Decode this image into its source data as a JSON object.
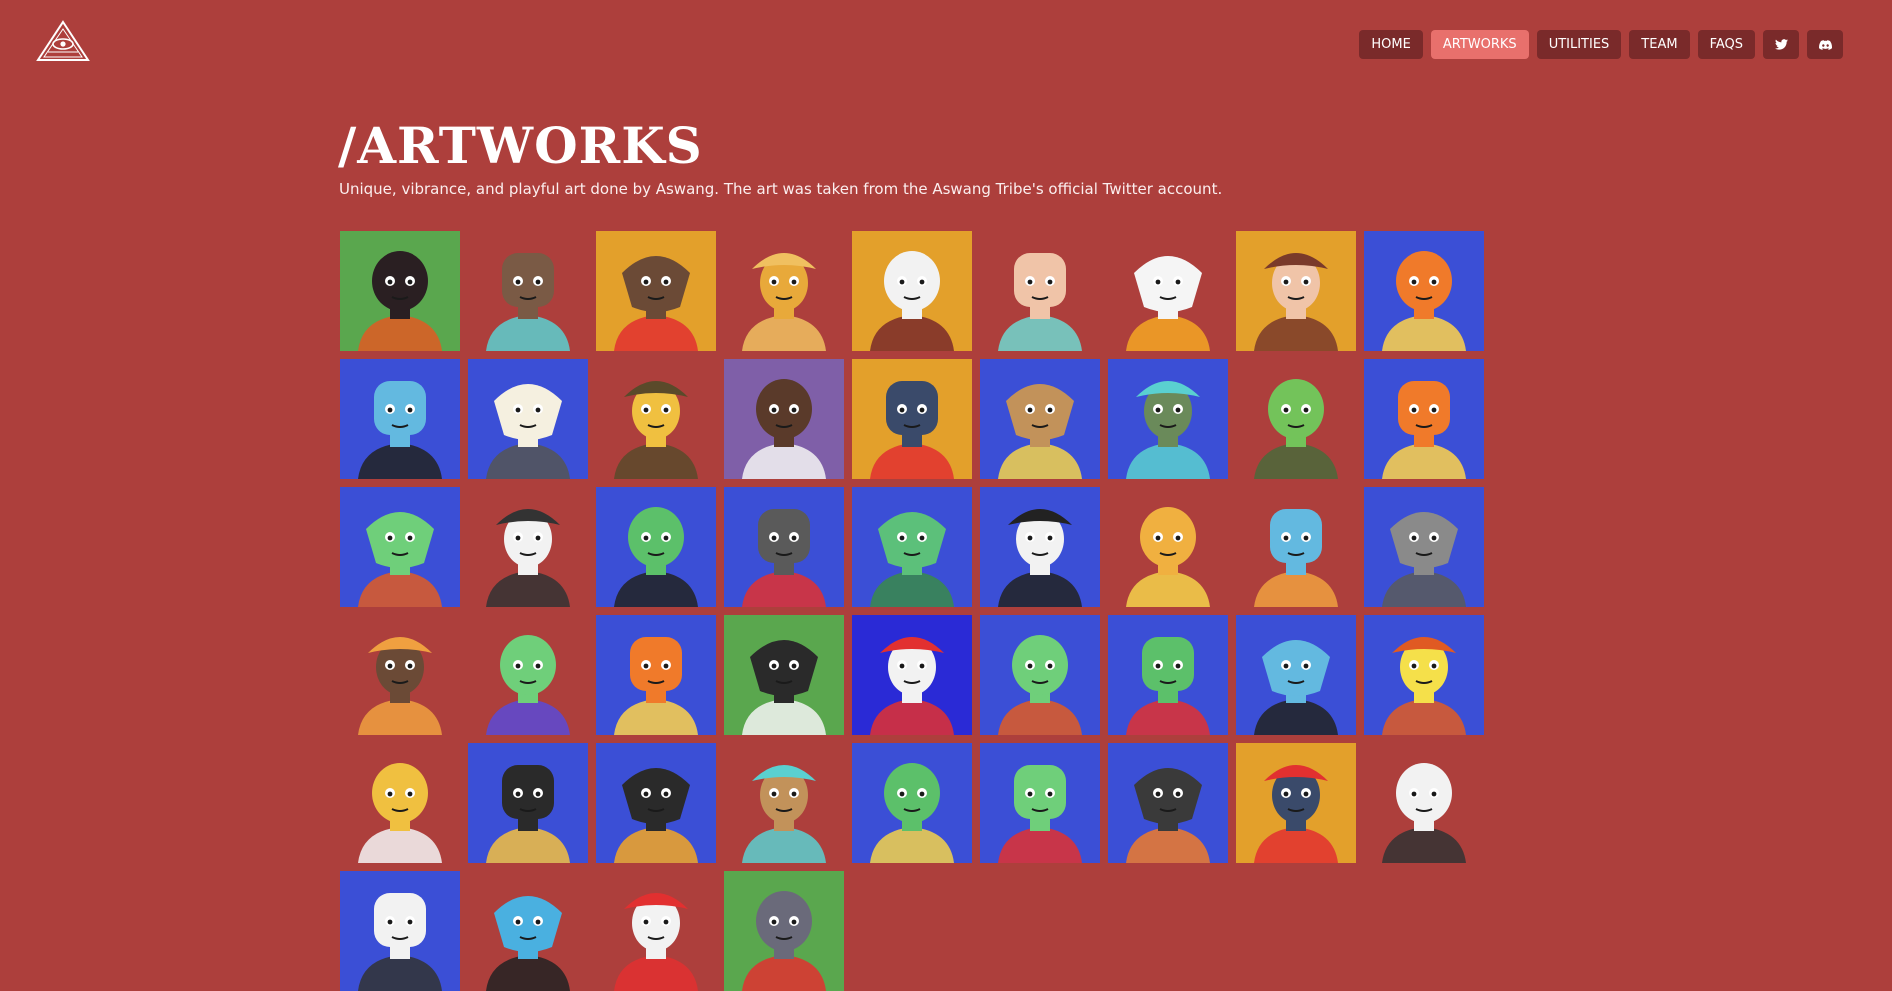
{
  "header": {
    "logo_icon": "eye-pyramid-logo-icon",
    "nav": [
      {
        "label": "HOME",
        "active": false
      },
      {
        "label": "ARTWORKS",
        "active": true
      },
      {
        "label": "UTILITIES",
        "active": false
      },
      {
        "label": "TEAM",
        "active": false
      },
      {
        "label": "FAQS",
        "active": false
      }
    ],
    "social": [
      {
        "icon": "twitter-icon"
      },
      {
        "icon": "discord-icon"
      }
    ]
  },
  "page": {
    "title": "/ARTWORKS",
    "subtitle": "Unique, vibrance, and playful art done by Aswang. The art was taken from the Aswang Tribe's official Twitter account."
  },
  "colors": {
    "background": "#ad3f3c",
    "nav_button": "#7a2a2a",
    "nav_active": "#e8706c"
  },
  "artworks": [
    {
      "bg": "#5aa74e",
      "skin": "#2a1f22",
      "accent": "#e05a23"
    },
    {
      "bg": "#ad3f3c",
      "skin": "#7a5a45",
      "accent": "#5ad0d0"
    },
    {
      "bg": "#e3a02b",
      "skin": "#6b4a36",
      "accent": "#e23030"
    },
    {
      "bg": "#ad3f3c",
      "skin": "#e8a93a",
      "accent": "#f0c060"
    },
    {
      "bg": "#e3a02b",
      "skin": "#f2f2f2",
      "accent": "#7a2a2a"
    },
    {
      "bg": "#ad3f3c",
      "skin": "#f0c4a8",
      "accent": "#6fd8d0"
    },
    {
      "bg": "#ad3f3c",
      "skin": "#f5f5f5",
      "accent": "#f5a623"
    },
    {
      "bg": "#e3a02b",
      "skin": "#f0c4a8",
      "accent": "#7a3a2a"
    },
    {
      "bg": "#3b4fd6",
      "skin": "#f07a2a",
      "accent": "#ffd24a"
    },
    {
      "bg": "#3b4fd6",
      "skin": "#63b9e0",
      "accent": "#222222"
    },
    {
      "bg": "#3b4fd6",
      "skin": "#f5f0e0",
      "accent": "#555555"
    },
    {
      "bg": "#ad3f3c",
      "skin": "#f0c040",
      "accent": "#5a4a2a"
    },
    {
      "bg": "#7f5fa8",
      "skin": "#5a3a2a",
      "accent": "#f5f5f5"
    },
    {
      "bg": "#e3a02b",
      "skin": "#3a4a6a",
      "accent": "#e23030"
    },
    {
      "bg": "#3b4fd6",
      "skin": "#c2925a",
      "accent": "#f5d24a"
    },
    {
      "bg": "#3b4fd6",
      "skin": "#6a8a5a",
      "accent": "#5ad0d0"
    },
    {
      "bg": "#ad3f3c",
      "skin": "#73c35a",
      "accent": "#4a6a3a"
    },
    {
      "bg": "#3b4fd6",
      "skin": "#f07a2a",
      "accent": "#ffd24a"
    },
    {
      "bg": "#3b4fd6",
      "skin": "#6fcf7a",
      "accent": "#e05a23"
    },
    {
      "bg": "#ad3f3c",
      "skin": "#f2f2f2",
      "accent": "#333333"
    },
    {
      "bg": "#3b4fd6",
      "skin": "#5cc06a",
      "accent": "#222222"
    },
    {
      "bg": "#3b4fd6",
      "skin": "#5a5a5a",
      "accent": "#e23030"
    },
    {
      "bg": "#3b4fd6",
      "skin": "#5cc07a",
      "accent": "#3a8a4a"
    },
    {
      "bg": "#3b4fd6",
      "skin": "#f2f2f2",
      "accent": "#222222"
    },
    {
      "bg": "#ad3f3c",
      "skin": "#f0b040",
      "accent": "#f5d24a"
    },
    {
      "bg": "#ad3f3c",
      "skin": "#63b9e0",
      "accent": "#f0a040"
    },
    {
      "bg": "#3b4fd6",
      "skin": "#8a8a8a",
      "accent": "#5a5a5a"
    },
    {
      "bg": "#ad3f3c",
      "skin": "#6b4a36",
      "accent": "#f0a040"
    },
    {
      "bg": "#ad3f3c",
      "skin": "#6fcf7a",
      "accent": "#5a4ad6"
    },
    {
      "bg": "#3b4fd6",
      "skin": "#f07a2a",
      "accent": "#ffd24a"
    },
    {
      "bg": "#5aa74e",
      "skin": "#2a2a2a",
      "accent": "#f5f5f5"
    },
    {
      "bg": "#2a2ad6",
      "skin": "#f2f2f2",
      "accent": "#e23030"
    },
    {
      "bg": "#3b4fd6",
      "skin": "#6fcf7a",
      "accent": "#e05a23"
    },
    {
      "bg": "#3b4fd6",
      "skin": "#5cc06a",
      "accent": "#e23030"
    },
    {
      "bg": "#3b4fd6",
      "skin": "#63b9e0",
      "accent": "#222222"
    },
    {
      "bg": "#3b4fd6",
      "skin": "#f5e04a",
      "accent": "#e05a23"
    },
    {
      "bg": "#ad3f3c",
      "skin": "#f0c040",
      "accent": "#f5f5f5"
    },
    {
      "bg": "#3b4fd6",
      "skin": "#2a2a2a",
      "accent": "#f5c040"
    },
    {
      "bg": "#3b4fd6",
      "skin": "#2a2a2a",
      "accent": "#f5a623"
    },
    {
      "bg": "#ad3f3c",
      "skin": "#c2925a",
      "accent": "#5ad0d0"
    },
    {
      "bg": "#3b4fd6",
      "skin": "#5cc06a",
      "accent": "#f5d24a"
    },
    {
      "bg": "#3b4fd6",
      "skin": "#6fcf7a",
      "accent": "#e23030"
    },
    {
      "bg": "#3b4fd6",
      "skin": "#3a3a3a",
      "accent": "#f07a2a"
    },
    {
      "bg": "#e3a02b",
      "skin": "#3a4a6a",
      "accent": "#e23030"
    },
    {
      "bg": "#ad3f3c",
      "skin": "#f2f2f2",
      "accent": "#333333"
    },
    {
      "bg": "#3b4fd6",
      "skin": "#f2f2f2",
      "accent": "#333333"
    },
    {
      "bg": "#ad3f3c",
      "skin": "#4ab0e0",
      "accent": "#222222"
    },
    {
      "bg": "#ad3f3c",
      "skin": "#f2f2f2",
      "accent": "#e23030"
    },
    {
      "bg": "#5aa74e",
      "skin": "#6a6a7a",
      "accent": "#e23030"
    }
  ]
}
